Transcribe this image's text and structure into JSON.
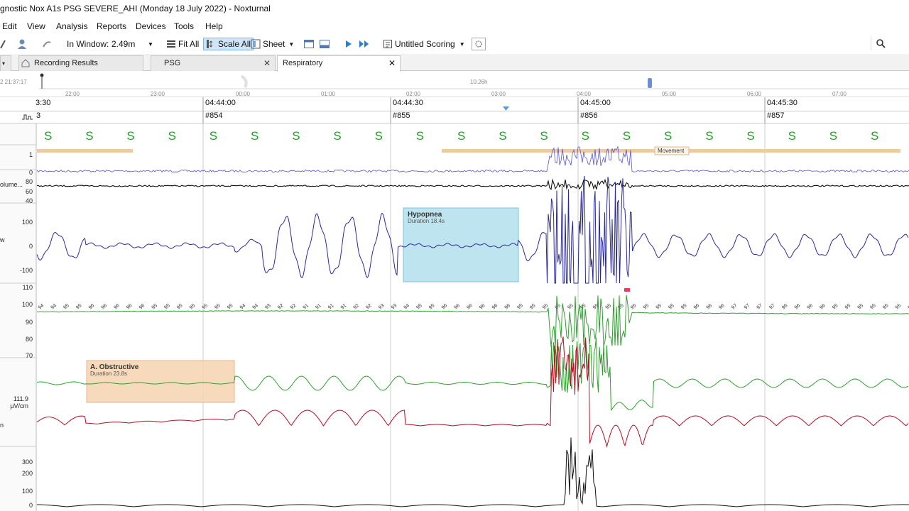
{
  "window": {
    "title": "gnostic Nox A1s PSG SEVERE_AHI (Monday 18 July 2022)  - Noxturnal"
  },
  "menu": [
    "Edit",
    "View",
    "Analysis",
    "Reports",
    "Devices",
    "Tools",
    "Help"
  ],
  "toolbar": {
    "in_window_label": "In Window:",
    "in_window_value": "2.49m",
    "fit_all": "Fit All",
    "scale_all": "Scale All",
    "sheet": "Sheet",
    "scoring": "Untitled Scoring"
  },
  "tabs": [
    {
      "label": "Recording Results"
    },
    {
      "label": "PSG"
    },
    {
      "label": "Respiratory"
    }
  ],
  "overview": {
    "start_time": "2 21:37:17",
    "hours": [
      "22:00",
      "23:00",
      "00:00",
      "01:00",
      "02:00",
      "03:00",
      "04:00",
      "05:00",
      "06:00",
      "07:00"
    ],
    "duration": "10.26h"
  },
  "time_ruler": [
    "3:30",
    "04:44:00",
    "04:44:30",
    "04:45:00",
    "04:45:30"
  ],
  "epochs": [
    "3",
    "#854",
    "#855",
    "#856",
    "#857"
  ],
  "sleep_stage_label": "S",
  "channels": {
    "activity_axis": [
      "1",
      "0"
    ],
    "volume_label": "olume...",
    "volume_axis": [
      "80",
      "60",
      "40"
    ],
    "flow_label": "w",
    "flow_axis": [
      "100",
      "0",
      "-100"
    ],
    "spo2_axis": [
      "110",
      "100",
      "90",
      "80",
      "70"
    ],
    "spo2_values": [
      "94",
      "94",
      "95",
      "95",
      "96",
      "96",
      "96",
      "96",
      "96",
      "95",
      "95",
      "95",
      "95",
      "95",
      "95",
      "95",
      "94",
      "94",
      "93",
      "92",
      "92",
      "91",
      "91",
      "91",
      "91",
      "92",
      "92",
      "93",
      "93",
      "94",
      "95",
      "95",
      "96",
      "96",
      "96",
      "96",
      "96",
      "96",
      "95",
      "95",
      "95",
      "95",
      "95",
      "95",
      "95",
      "95",
      "95",
      "95",
      "95",
      "95",
      "95",
      "95",
      "96",
      "96",
      "96",
      "97",
      "97",
      "97",
      "97",
      "96",
      "96",
      "96",
      "96",
      "95",
      "95",
      "95",
      "95",
      "95",
      "95",
      "95",
      "95",
      "95"
    ],
    "belt_scale_value": "111.9",
    "belt_scale_unit": "µV/cm",
    "belt_label": "n",
    "bottom_axis": [
      "300",
      "200",
      "100",
      "0"
    ]
  },
  "events": {
    "hypopnea": {
      "title": "Hypopnea",
      "duration": "Duration 18.4s"
    },
    "obstructive": {
      "title": "A. Obstructive",
      "duration": "Duration 23.8s"
    },
    "movement": "Movement"
  },
  "colors": {
    "stage": "#23a023",
    "flow": "#2a2a9a",
    "volume": "#111111",
    "activity": "#5555cc",
    "spo2": "#2fa02f",
    "thorax": "#2fa02f",
    "abdomen": "#b01020",
    "hypopnea_fill": "#a8dcea",
    "obstructive_fill": "#f6d3b0",
    "movement_bar": "#f0c9a0"
  },
  "icons": [
    "pencil-icon",
    "user-icon",
    "marker-icon",
    "fit-all-icon",
    "scale-all-icon",
    "sheet-icon",
    "layout-single-icon",
    "layout-split-icon",
    "play-icon",
    "fast-forward-icon",
    "scoring-icon",
    "event-tool-icon",
    "search-icon",
    "home-icon"
  ]
}
